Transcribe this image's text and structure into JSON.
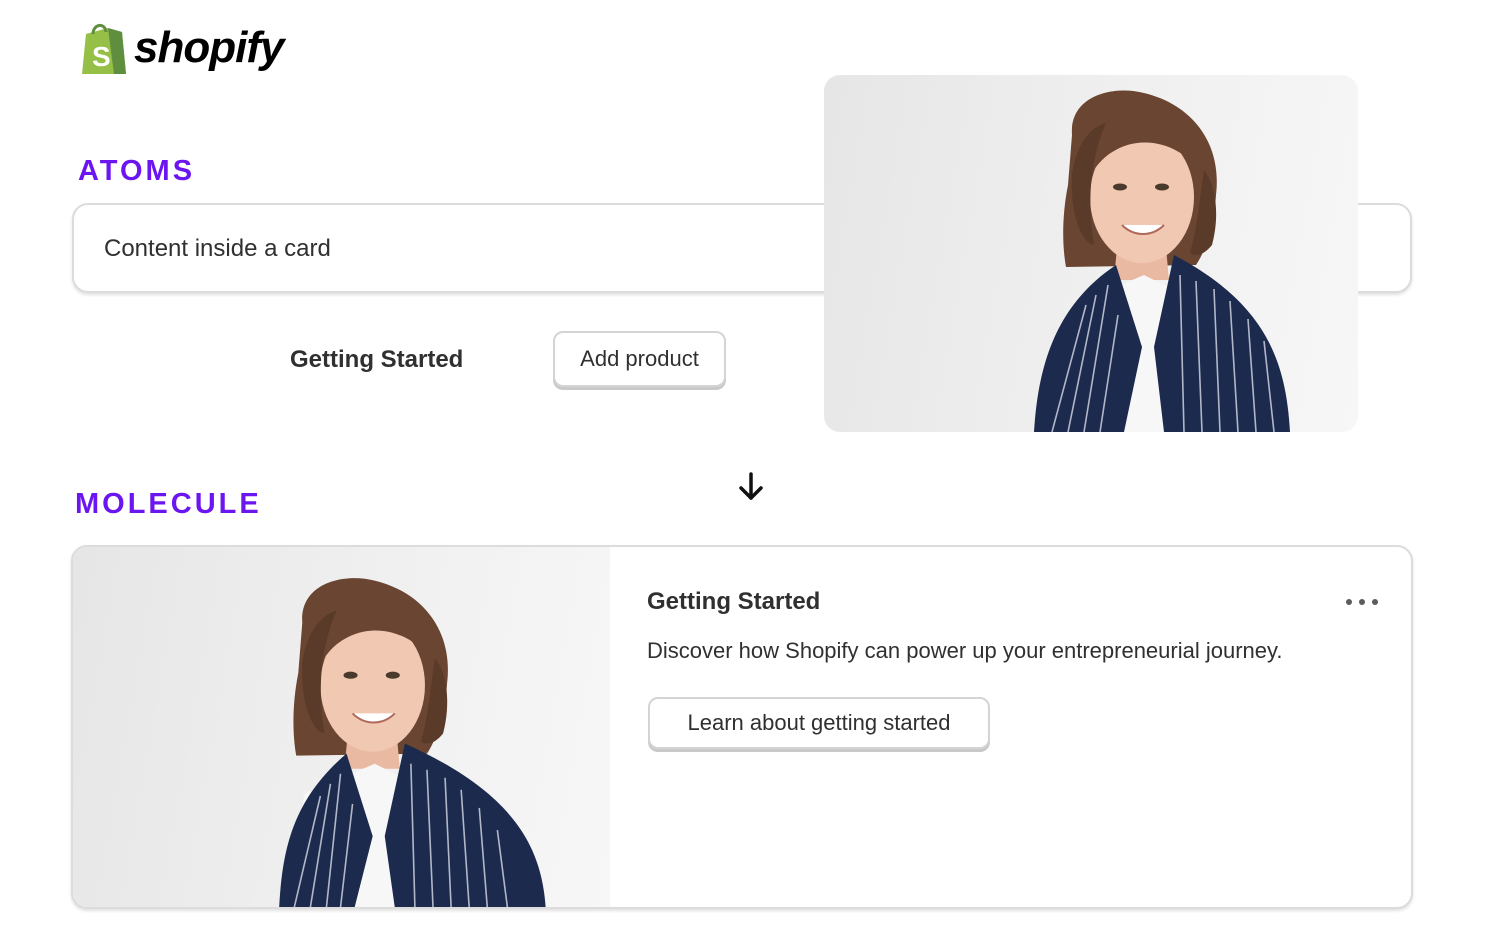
{
  "brand": {
    "name": "shopify",
    "logo_icon": "shopify-bag-icon",
    "bag_color": "#95bf47"
  },
  "colors": {
    "accent": "#6b16f0",
    "text": "#303030"
  },
  "sections": {
    "atoms": {
      "label": "ATOMS",
      "card_text": "Content inside a card",
      "heading": "Getting Started",
      "button_label": "Add product",
      "image": "portrait-photo"
    },
    "arrow_icon": "arrow-down-icon",
    "molecule": {
      "label": "MOLECULE",
      "title": "Getting Started",
      "description": "Discover how Shopify can power up your entrepreneurial journey.",
      "button_label": "Learn about getting started",
      "menu_icon": "more-horizontal-icon",
      "image": "portrait-photo"
    }
  }
}
